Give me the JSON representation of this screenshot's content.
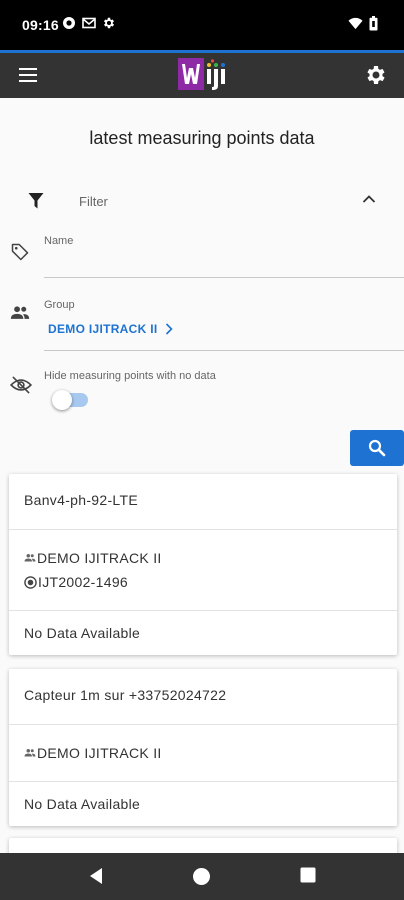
{
  "status_bar": {
    "time": "09:16",
    "left_icons": [
      "record-icon",
      "mail-icon",
      "settings-small-icon"
    ],
    "right_icons": [
      "wifi-icon",
      "battery-icon"
    ]
  },
  "app_bar": {
    "logo_text": "Wiji",
    "background": "#333333",
    "accent": "#1e73d2"
  },
  "page": {
    "title": "latest measuring points data"
  },
  "filter": {
    "label": "Filter",
    "expanded": true,
    "name_label": "Name",
    "name_value": "",
    "group_label": "Group",
    "group_value": "DEMO IJITRACK II",
    "hide_label": "Hide measuring points with no data",
    "hide_enabled": false
  },
  "cards": [
    {
      "title": "Banv4-ph-92-LTE",
      "group": "DEMO IJITRACK II",
      "device": "IJT2002-1496",
      "status": "No Data Available"
    },
    {
      "title": "Capteur 1m sur +33752024722",
      "group": "DEMO IJITRACK II",
      "status": "No Data Available"
    }
  ],
  "nav": {
    "buttons": [
      "back-icon",
      "home-icon",
      "recents-icon"
    ]
  }
}
